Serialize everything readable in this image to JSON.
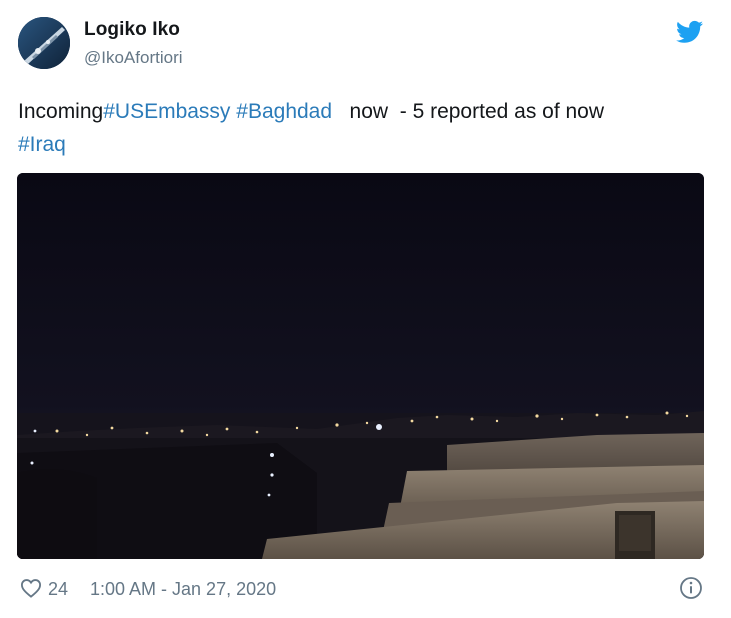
{
  "user": {
    "display_name": "Logiko Iko",
    "handle": "@IkoAfortiori",
    "avatar_icon": "avatar-image"
  },
  "brand": {
    "icon": "twitter-bird-icon",
    "color": "#1da1f2"
  },
  "tweet": {
    "text_parts": [
      {
        "text": "Incoming",
        "type": "text"
      },
      {
        "text": "#USEmbassy",
        "type": "hashtag"
      },
      {
        "text": " ",
        "type": "text"
      },
      {
        "text": "#Baghdad",
        "type": "hashtag"
      },
      {
        "text": "   now  - 5 reported as of now",
        "type": "text"
      },
      {
        "text": "#Iraq",
        "type": "hashtag"
      }
    ],
    "hashtag_color": "#2b7bb9"
  },
  "media": {
    "kind": "video-still",
    "icon": "night-city-skyline-image"
  },
  "footer": {
    "like_icon": "heart-icon",
    "like_count": "24",
    "timestamp": "1:00 AM - Jan 27, 2020",
    "info_icon": "info-icon"
  }
}
